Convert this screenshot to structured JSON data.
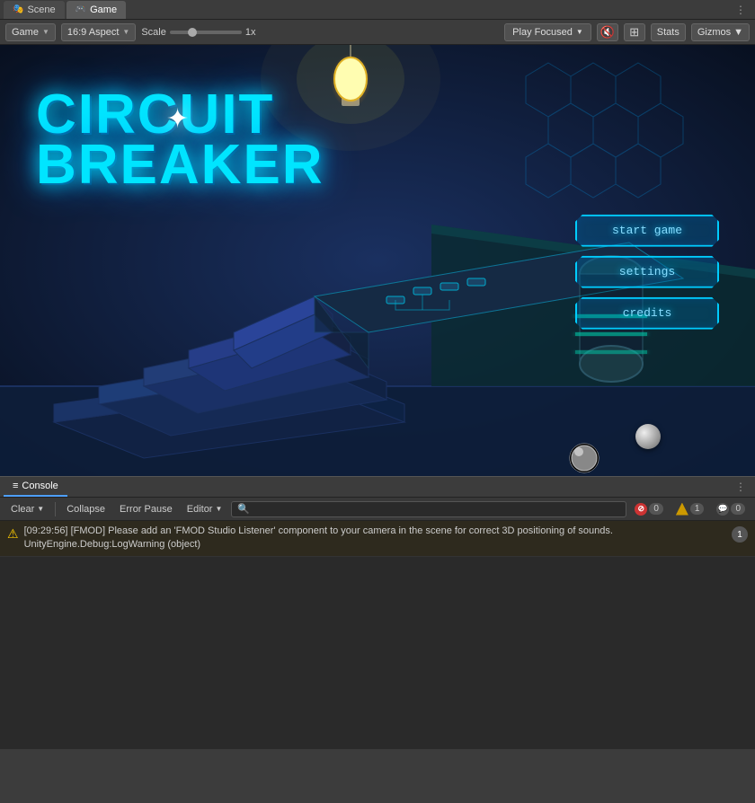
{
  "tabs": [
    {
      "id": "scene",
      "label": "Scene",
      "icon": "🎭",
      "active": false
    },
    {
      "id": "game",
      "label": "Game",
      "icon": "🎮",
      "active": true
    }
  ],
  "toolbar": {
    "game_dropdown": "Game",
    "aspect_dropdown": "16:9 Aspect",
    "scale_label": "Scale",
    "scale_value": "1x",
    "play_focused_label": "Play Focused",
    "stats_label": "Stats",
    "gizmos_label": "Gizmos"
  },
  "game_menu": {
    "start_game": "start game",
    "settings": "settings",
    "credits": "credits"
  },
  "console": {
    "tab_label": "Console",
    "clear_label": "Clear",
    "collapse_label": "Collapse",
    "error_pause_label": "Error Pause",
    "editor_label": "Editor",
    "search_placeholder": "",
    "error_count": "0",
    "warning_count": "1",
    "log_count": "0",
    "message": {
      "timestamp": "[09:29:56]",
      "source": "[FMOD]",
      "text": "Please add an 'FMOD Studio Listener' component to your camera in the scene for correct 3D positioning of sounds.\nUnityEngine.Debug:LogWarning (object)",
      "count": "1"
    }
  }
}
